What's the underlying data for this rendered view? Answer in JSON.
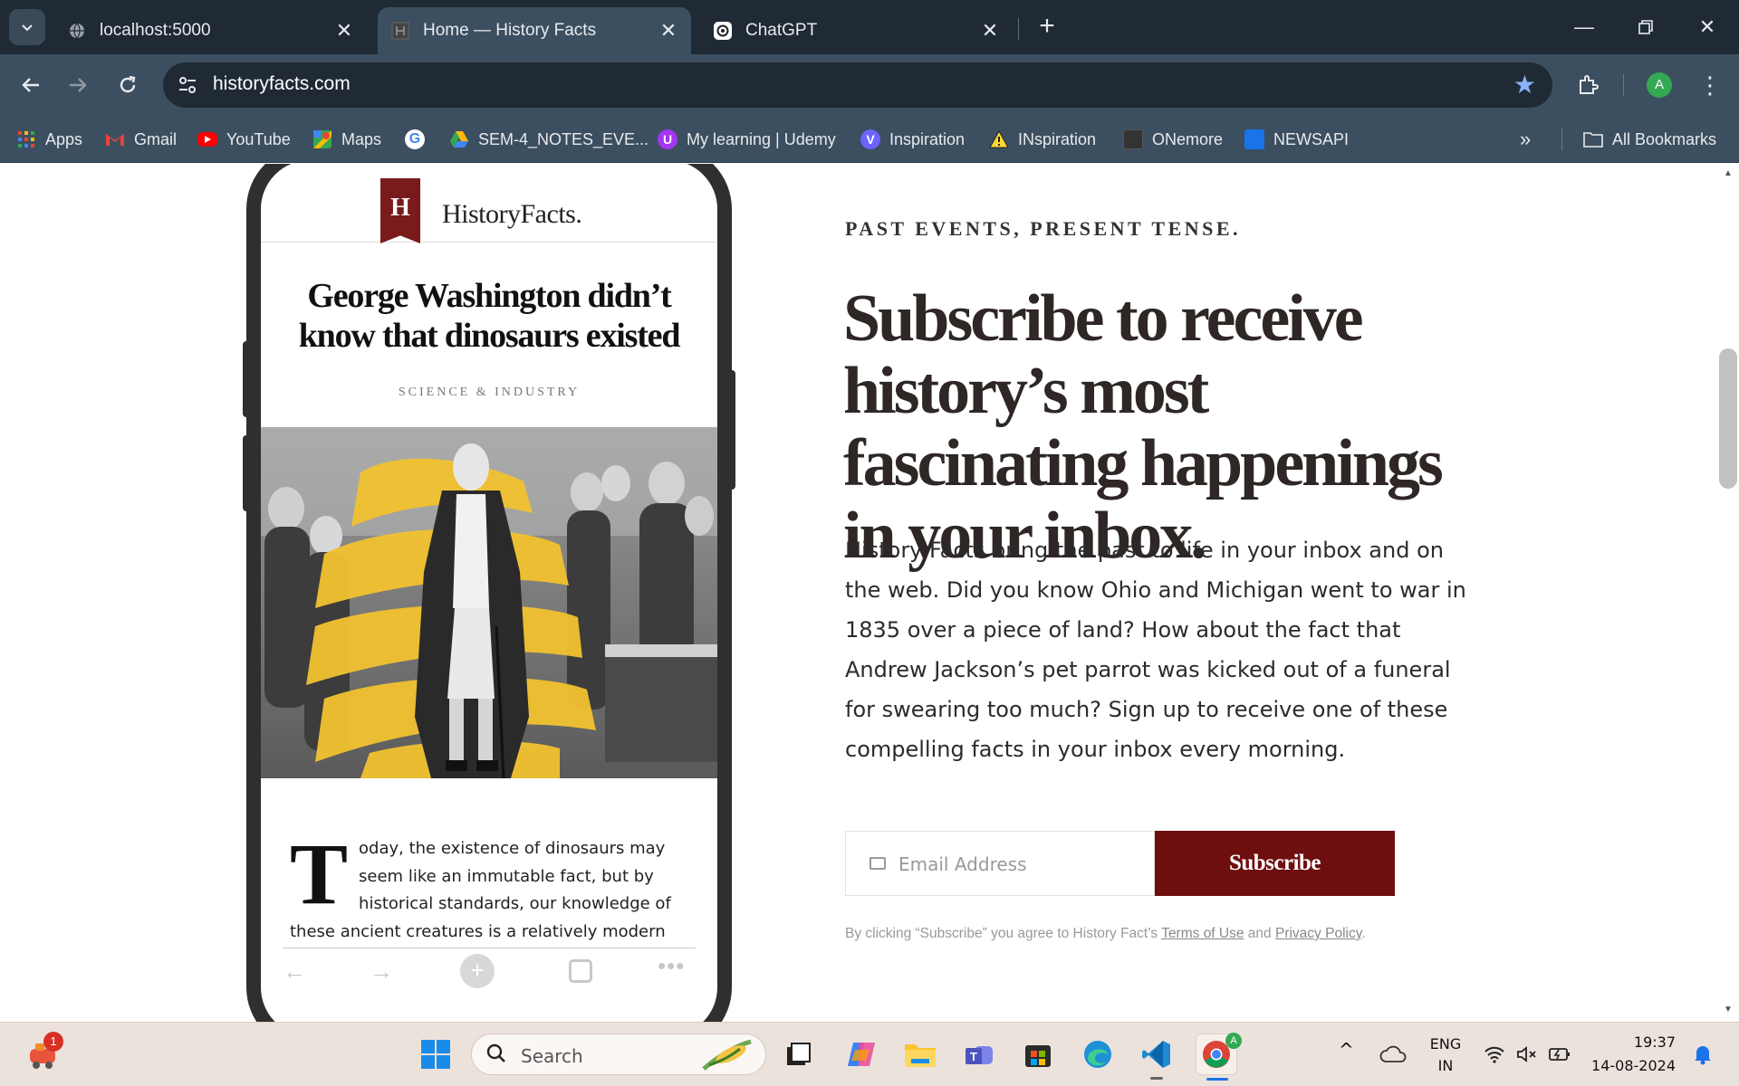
{
  "browser": {
    "tabs": [
      {
        "title": "localhost:5000",
        "active": false
      },
      {
        "title": "Home — History Facts",
        "active": true
      },
      {
        "title": "ChatGPT",
        "active": false
      }
    ],
    "url": "historyfacts.com",
    "profile_initial": "A",
    "bookmarks": [
      {
        "label": "Apps"
      },
      {
        "label": "Gmail"
      },
      {
        "label": "YouTube"
      },
      {
        "label": "Maps"
      },
      {
        "label": ""
      },
      {
        "label": "SEM-4_NOTES_EVE..."
      },
      {
        "label": "My learning | Udemy"
      },
      {
        "label": "Inspiration"
      },
      {
        "label": "INspiration"
      },
      {
        "label": "ONemore"
      },
      {
        "label": "NEWSAPI"
      }
    ],
    "all_bookmarks": "All Bookmarks"
  },
  "phone": {
    "logo": "HistoryFacts.",
    "logo_mark": "H",
    "article_title": "George Washington didn’t know that dinosaurs existed",
    "category": "SCIENCE & INDUSTRY",
    "dropcap": "T",
    "body": "oday, the existence of dinosaurs may seem like an immutable fact, but by historical standards, our knowledge of these ancient creatures is a relatively modern development. In fact, the very concept of"
  },
  "signup": {
    "eyebrow": "PAST EVENTS, PRESENT TENSE.",
    "headline": "Subscribe to receive history’s most fascinating happenings in your inbox.",
    "lede": "History Facts bring the past to life in your inbox and on the web. Did you know Ohio and Michigan went to war in 1835 over a piece of land? How about the fact that Andrew Jackson’s pet parrot was kicked out of a funeral for swearing too much? Sign up to receive one of these compelling facts in your inbox every morning.",
    "email_placeholder": "Email Address",
    "email_value": "",
    "button": "Subscribe",
    "legal_prefix": "By clicking “Subscribe” you agree to History Fact’s ",
    "terms": "Terms of Use",
    "legal_and": " and ",
    "privacy": "Privacy Policy",
    "legal_suffix": "."
  },
  "taskbar": {
    "search": "Search",
    "notification_count": "1",
    "lang_1": "ENG",
    "lang_2": "IN",
    "time": "19:37",
    "date": "14-08-2024"
  },
  "colors": {
    "brand_maroon": "#6e0e0e",
    "chrome_dark": "#1f2a35",
    "chrome_mid": "#3c4f60",
    "highlight_yellow": "#f2c230"
  }
}
